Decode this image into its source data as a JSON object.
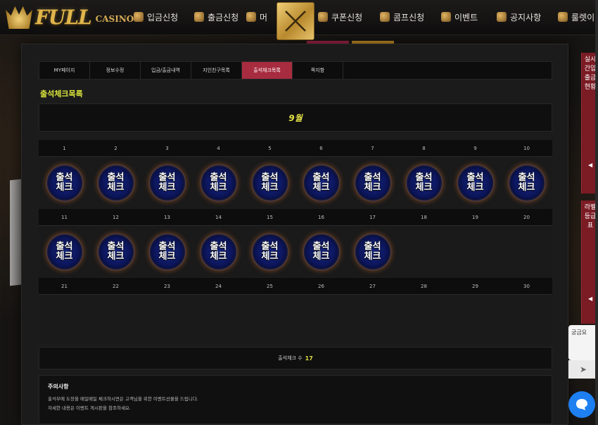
{
  "header": {
    "logo_main": "FULL",
    "logo_sub": "CASINO",
    "nav": [
      {
        "label": "입금신청",
        "icon": "deposit-icon"
      },
      {
        "label": "출금신청",
        "icon": "withdraw-icon"
      },
      {
        "label": "머",
        "icon": "money-icon"
      },
      {
        "label": "쿠폰신청",
        "icon": "coupon-icon"
      },
      {
        "label": "콤프신청",
        "icon": "comp-icon"
      },
      {
        "label": "이벤트",
        "icon": "event-icon"
      },
      {
        "label": "공지사항",
        "icon": "notice-icon"
      },
      {
        "label": "룰렛이벤트",
        "icon": "roulette-icon"
      }
    ]
  },
  "tabs": [
    {
      "label": "MY페이지"
    },
    {
      "label": "정보수정"
    },
    {
      "label": "입금/출금내역"
    },
    {
      "label": "지인친구목록"
    },
    {
      "label": "출석체크목록"
    },
    {
      "label": "쪽지함"
    }
  ],
  "active_tab": 4,
  "section_title": "출석체크목록",
  "month_label": "9월",
  "calendar": {
    "rows": [
      {
        "days": [
          "1",
          "2",
          "3",
          "4",
          "5",
          "6",
          "7",
          "8",
          "9",
          "10"
        ],
        "stamped": [
          true,
          true,
          true,
          true,
          true,
          true,
          true,
          true,
          true,
          true
        ]
      },
      {
        "days": [
          "11",
          "12",
          "13",
          "14",
          "15",
          "16",
          "17",
          "18",
          "19",
          "20"
        ],
        "stamped": [
          true,
          true,
          true,
          true,
          true,
          true,
          true,
          false,
          false,
          false
        ]
      },
      {
        "days": [
          "21",
          "22",
          "23",
          "24",
          "25",
          "26",
          "27",
          "28",
          "29",
          "30"
        ],
        "stamped": [
          false,
          false,
          false,
          false,
          false,
          false,
          false,
          false,
          false,
          false
        ]
      }
    ],
    "stamp_text": "출석체크"
  },
  "count": {
    "label": "출석체크 수",
    "value": "17"
  },
  "notice": {
    "title": "주의사항",
    "lines": [
      "출석부에 도장을 매일매일 체크하시면은 고객님을 위한 이벤트선물을 드립니다.",
      "자세한 내용은 이벤트 게시판을 참조하세요."
    ]
  },
  "side": {
    "banner1": "실시간입출금현황",
    "banner2": "라벨등급표",
    "chat_partial": "궁금요"
  },
  "colors": {
    "accent_red": "#a82c3f",
    "highlight_yellow": "#e2df45",
    "gold": "#e0b64c"
  }
}
